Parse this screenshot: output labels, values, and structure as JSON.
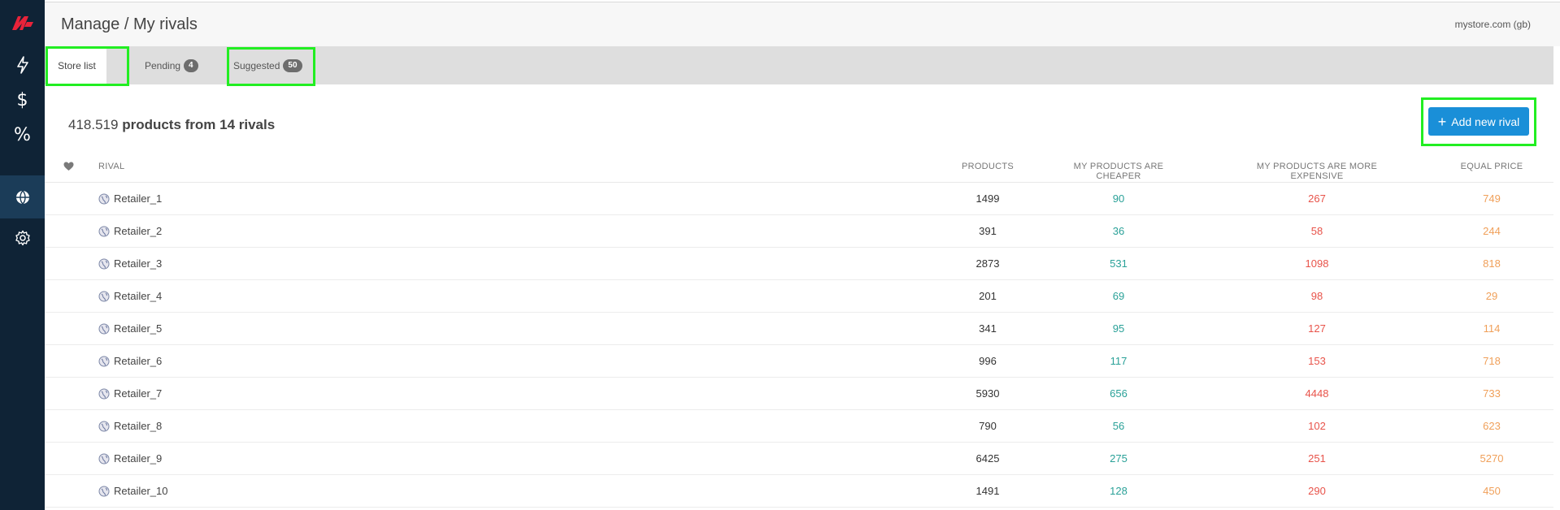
{
  "header": {
    "title": "Manage / My rivals",
    "store": "mystore.com (gb)"
  },
  "sidebar": {
    "items": [
      {
        "icon": "lightning-icon"
      },
      {
        "icon": "dollar-icon",
        "glyph": "$"
      },
      {
        "icon": "percent-icon",
        "glyph": "%"
      },
      {
        "icon": "globe-icon",
        "active": true
      },
      {
        "icon": "gear-icon"
      }
    ]
  },
  "tabs": [
    {
      "label": "Store list",
      "active": true
    },
    {
      "label": "Pending",
      "badge": "4"
    },
    {
      "label": "Suggested",
      "badge": "50"
    }
  ],
  "summary": {
    "count": "418.519",
    "rest": "products from 14 rivals"
  },
  "add_button": {
    "plus": "+",
    "label": "Add new rival"
  },
  "table": {
    "columns": {
      "rival": "RIVAL",
      "products": "PRODUCTS",
      "cheaper": "MY PRODUCTS ARE CHEAPER",
      "expensive": "MY PRODUCTS ARE MORE EXPENSIVE",
      "equal": "EQUAL PRICE"
    },
    "rows": [
      {
        "name": "Retailer_1",
        "products": "1499",
        "cheaper": "90",
        "expensive": "267",
        "equal": "749"
      },
      {
        "name": "Retailer_2",
        "products": "391",
        "cheaper": "36",
        "expensive": "58",
        "equal": "244"
      },
      {
        "name": "Retailer_3",
        "products": "2873",
        "cheaper": "531",
        "expensive": "1098",
        "equal": "818"
      },
      {
        "name": "Retailer_4",
        "products": "201",
        "cheaper": "69",
        "expensive": "98",
        "equal": "29"
      },
      {
        "name": "Retailer_5",
        "products": "341",
        "cheaper": "95",
        "expensive": "127",
        "equal": "114"
      },
      {
        "name": "Retailer_6",
        "products": "996",
        "cheaper": "117",
        "expensive": "153",
        "equal": "718"
      },
      {
        "name": "Retailer_7",
        "products": "5930",
        "cheaper": "656",
        "expensive": "4448",
        "equal": "733"
      },
      {
        "name": "Retailer_8",
        "products": "790",
        "cheaper": "56",
        "expensive": "102",
        "equal": "623"
      },
      {
        "name": "Retailer_9",
        "products": "6425",
        "cheaper": "275",
        "expensive": "251",
        "equal": "5270"
      },
      {
        "name": "Retailer_10",
        "products": "1491",
        "cheaper": "128",
        "expensive": "290",
        "equal": "450"
      }
    ]
  },
  "colors": {
    "sidebar": "#0f2336",
    "accent": "#1a8fd8",
    "cheaper": "#2aa198",
    "expensive": "#e8534a",
    "equal": "#f0a05a",
    "highlight": "#22ee22",
    "logo": "#e8233a"
  }
}
